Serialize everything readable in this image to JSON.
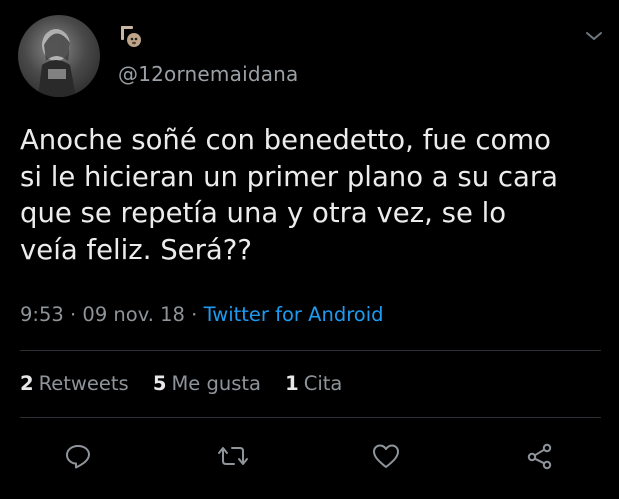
{
  "header": {
    "display_name_icon": "sloth-emoji-icon",
    "handle": "@12ornemaidana"
  },
  "tweet": {
    "text": "Anoche soñé con benedetto, fue como\nsi le hicieran un primer plano a su cara\nque se repetía una y otra vez, se lo\nveía feliz. Será??"
  },
  "meta": {
    "time": "9:53",
    "sep1": " · ",
    "date": "09 nov. 18",
    "sep2": " · ",
    "source": "Twitter for Android"
  },
  "stats": {
    "retweets_count": "2",
    "retweets_label": "Retweets",
    "likes_count": "5",
    "likes_label": "Me gusta",
    "quotes_count": "1",
    "quotes_label": "Cita"
  },
  "actions": [
    "reply-icon",
    "retweet-icon",
    "like-icon",
    "share-icon"
  ],
  "colors": {
    "background": "#000000",
    "text": "#ececec",
    "muted": "#8e9499",
    "link": "#1d9bf0"
  }
}
